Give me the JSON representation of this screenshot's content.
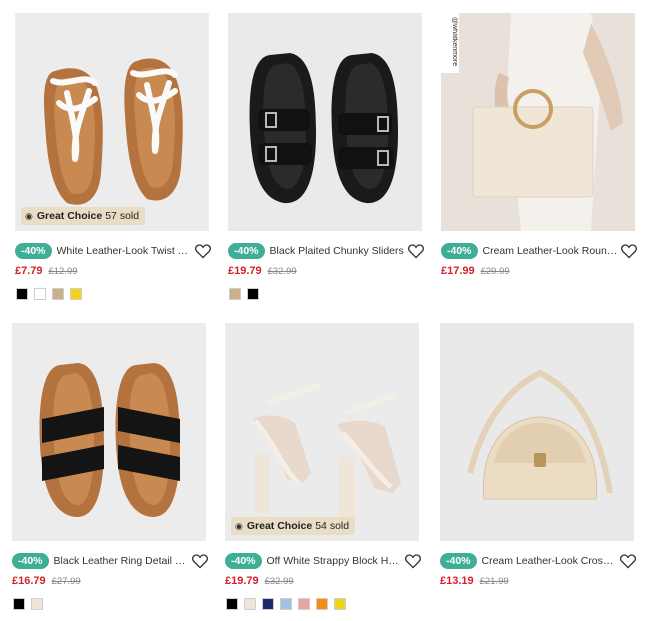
{
  "products": [
    {
      "discount": "-40%",
      "name": "White Leather-Look Twist Toe ...",
      "price": "£7.79",
      "was": "£12.99",
      "badge": {
        "label": "Great Choice",
        "sold": "57 sold"
      },
      "swatches": [
        "#000000",
        "#ffffff",
        "#c8b08a",
        "#f2d21b"
      ],
      "image": "white-twist-toe-sandals"
    },
    {
      "discount": "-40%",
      "name": "Black Plaited Chunky Sliders",
      "price": "£19.79",
      "was": "£32.99",
      "swatches": [
        "#c8b08a",
        "#000000"
      ],
      "image": "black-plaited-sliders"
    },
    {
      "discount": "-40%",
      "name": "Cream Leather-Look Round H...",
      "price": "£17.99",
      "was": "£29.99",
      "swatches": [],
      "image": "cream-ring-handle-bag",
      "watermark": "@whatkenmore"
    },
    {
      "discount": "-40%",
      "name": "Black Leather Ring Detail Mules",
      "price": "£16.79",
      "was": "£27.99",
      "swatches": [
        "#000000",
        "#efe6d8"
      ],
      "image": "black-ring-mules"
    },
    {
      "discount": "-40%",
      "name": "Off White Strappy Block Heel ...",
      "price": "£19.79",
      "was": "£32.99",
      "badge": {
        "label": "Great Choice",
        "sold": "54 sold"
      },
      "swatches": [
        "#000000",
        "#efe6d8",
        "#1d2a6b",
        "#9fc3e6",
        "#e8a3a3",
        "#f28c12",
        "#f2d21b"
      ],
      "image": "off-white-block-heels"
    },
    {
      "discount": "-40%",
      "name": "Cream Leather-Look Cross Bo...",
      "price": "£13.19",
      "was": "£21.99",
      "swatches": [],
      "image": "cream-saddle-crossbody-bag"
    }
  ]
}
